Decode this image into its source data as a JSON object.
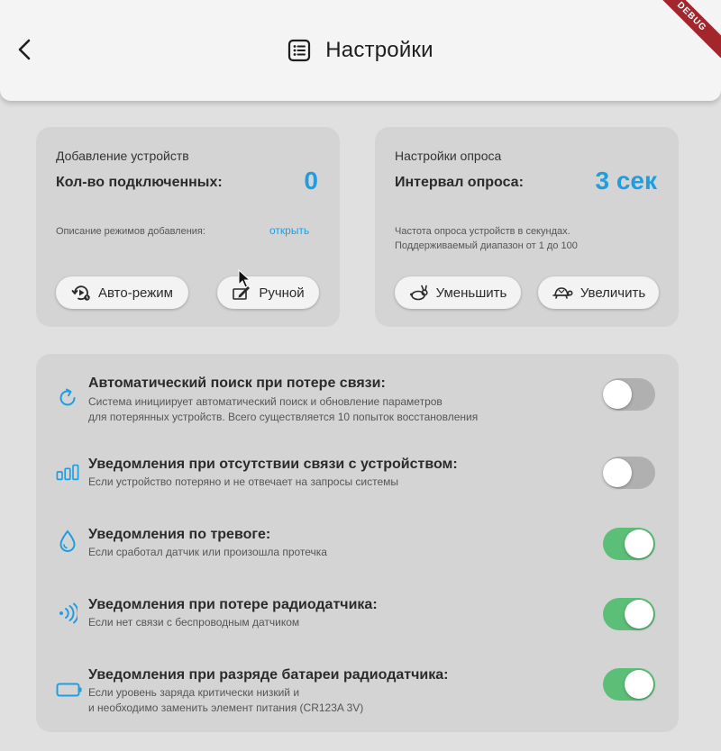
{
  "appbar": {
    "title": "Настройки",
    "debug_banner": "DEBUG"
  },
  "device_card": {
    "title": "Добавление устройств",
    "count_label": "Кол-во подключенных:",
    "count_value": "0",
    "modes_desc": "Описание режимов добавления:",
    "open_link": "открыть",
    "auto_button": "Авто-режим",
    "manual_button": "Ручной"
  },
  "poll_card": {
    "title": "Настройки опроса",
    "interval_label": "Интервал опроса:",
    "interval_value": "3 сек",
    "desc_line1": "Частота опроса устройств в секундах.",
    "desc_line2": "Поддерживаемый диапазон от 1 до 100",
    "decrease_button": "Уменьшить",
    "increase_button": "Увеличить"
  },
  "settings": [
    {
      "icon": "refresh-icon",
      "title": "Автоматический поиск при потере связи:",
      "desc_line1": "Система инициирует автоматический поиск и обновление параметров",
      "desc_line2": "для потерянных устройств. Всего существляется 10 попыток восстановления",
      "enabled": false
    },
    {
      "icon": "signal-bars-icon",
      "title": "Уведомления при отсутствии связи с устройством:",
      "desc_line1": "Если устройство потеряно и не отвечает на запросы системы",
      "desc_line2": "",
      "enabled": false
    },
    {
      "icon": "water-drop-icon",
      "title": "Уведомления по тревоге:",
      "desc_line1": "Если сработал датчик или произошла протечка",
      "desc_line2": "",
      "enabled": true
    },
    {
      "icon": "wireless-signal-icon",
      "title": "Уведомления при потере радиодатчика:",
      "desc_line1": "Если нет связи с беспроводным датчиком",
      "desc_line2": "",
      "enabled": true
    },
    {
      "icon": "battery-icon",
      "title": "Уведомления при разряде батареи радиодатчика:",
      "desc_line1": "Если уровень заряда критически низкий и",
      "desc_line2": "и необходимо заменить элемент питания (CR123A 3V)",
      "enabled": true
    }
  ],
  "colors": {
    "accent": "#1e9ee0",
    "toggle_on": "#5cbf78",
    "toggle_off": "#b0b0b0",
    "card_bg": "#d4d4d4",
    "page_bg": "#e0e0e0"
  }
}
